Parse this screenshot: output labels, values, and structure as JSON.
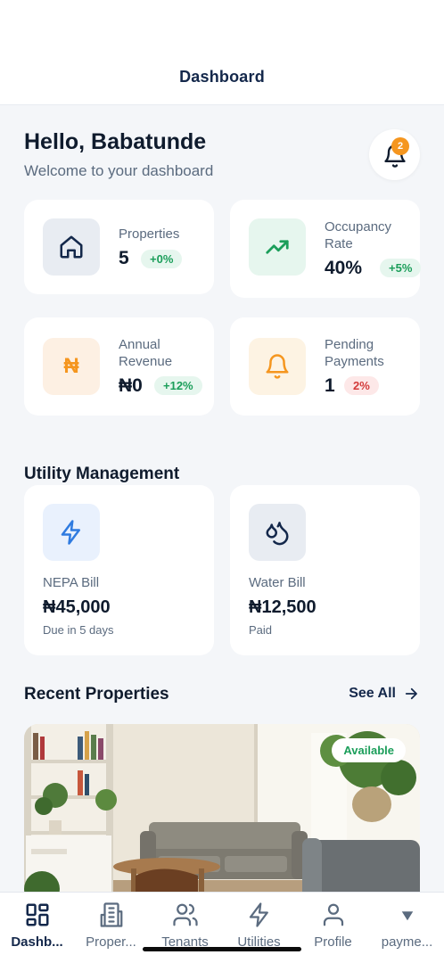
{
  "header": {
    "title": "Dashboard"
  },
  "greeting": {
    "title": "Hello, Babatunde",
    "subtitle": "Welcome to your dashboard"
  },
  "notifications": {
    "count": "2",
    "icon": "bell-icon",
    "badge_color": "#f5961f"
  },
  "stats": [
    {
      "label": "Properties",
      "value": "5",
      "change": "+0%",
      "icon": "home-icon",
      "tone": "green"
    },
    {
      "label": "Occupancy Rate",
      "value": "40%",
      "change": "+5%",
      "icon": "trending-up-icon",
      "tone": "green"
    },
    {
      "label": "Annual Revenue",
      "value": "₦0",
      "change": "+12%",
      "icon": "naira-icon",
      "tone": "green"
    },
    {
      "label": "Pending Payments",
      "value": "1",
      "change": "2%",
      "icon": "bell-icon",
      "tone": "red"
    }
  ],
  "utility": {
    "title": "Utility Management",
    "items": [
      {
        "name": "NEPA Bill",
        "amount": "₦45,000",
        "note": "Due in 5 days",
        "icon": "lightning-icon"
      },
      {
        "name": "Water Bill",
        "amount": "₦12,500",
        "note": "Paid",
        "icon": "water-drops-icon"
      }
    ]
  },
  "recent": {
    "title": "Recent Properties",
    "see_all": "See All",
    "property": {
      "status": "Available"
    }
  },
  "tabs": [
    {
      "label": "Dashb...",
      "icon": "dashboard-grid-icon",
      "active": true
    },
    {
      "label": "Proper...",
      "icon": "building-icon"
    },
    {
      "label": "Tenants",
      "icon": "users-icon"
    },
    {
      "label": "Utilities",
      "icon": "lightning-icon"
    },
    {
      "label": "Profile",
      "icon": "user-icon"
    },
    {
      "label": "payme...",
      "icon": "chevron-down-icon"
    }
  ],
  "colors": {
    "navy": "#14284b",
    "success": "#1b9e5a",
    "danger": "#d33a3a",
    "orange": "#f5961f",
    "background": "#f4f6f9"
  }
}
